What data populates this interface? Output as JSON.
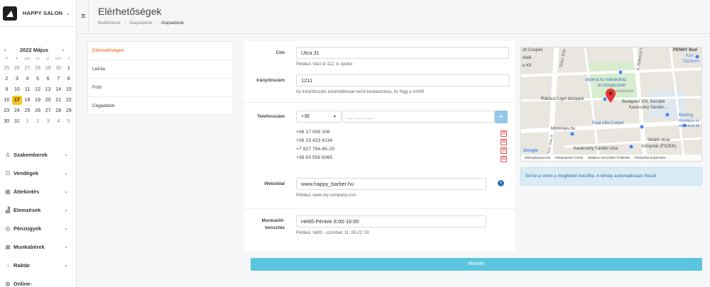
{
  "brand": {
    "name": "HAPPY SALON"
  },
  "calendar": {
    "month_label": "2022 Május",
    "prev": "‹",
    "next": "›",
    "weekdays": [
      "h",
      "k",
      "sze",
      "cs",
      "p",
      "szo",
      "v"
    ],
    "weeks": [
      [
        "25",
        "26",
        "27",
        "28",
        "29",
        "30",
        "1"
      ],
      [
        "2",
        "3",
        "4",
        "5",
        "6",
        "7",
        "8"
      ],
      [
        "9",
        "10",
        "11",
        "12",
        "13",
        "14",
        "15"
      ],
      [
        "16",
        "17",
        "18",
        "19",
        "20",
        "21",
        "22"
      ],
      [
        "23",
        "24",
        "25",
        "26",
        "27",
        "28",
        "29"
      ],
      [
        "30",
        "31",
        "1",
        "2",
        "3",
        "4",
        "5"
      ]
    ],
    "selected": "17"
  },
  "nav": {
    "items": [
      {
        "label": "Szakemberek",
        "icon": "person-icon"
      },
      {
        "label": "Vendégek",
        "icon": "users-icon"
      },
      {
        "label": "Áttekintés",
        "icon": "grid-icon"
      },
      {
        "label": "Elemzések",
        "icon": "chart-icon"
      },
      {
        "label": "Pénzügyek",
        "icon": "coin-icon"
      },
      {
        "label": "Munkabérek",
        "icon": "wallet-icon"
      },
      {
        "label": "Raktár",
        "icon": "box-icon"
      },
      {
        "label": "Online-",
        "icon": "globe-icon"
      }
    ]
  },
  "header": {
    "title": "Elérhetőségek",
    "breadcrumb": [
      "Beállítások",
      "Alapadatok",
      "Alapadatok"
    ]
  },
  "settings_menu": {
    "items": [
      "Elérhetőségek",
      "Leírás",
      "Fotó",
      "Cégadatok"
    ],
    "active": "Elérhetőségek"
  },
  "form": {
    "address": {
      "label": "Cím",
      "value": "Utca 31",
      "help": "Például, Váci út 112, d. épület"
    },
    "zip": {
      "label": "Irányítószám",
      "value": "1211",
      "help": "Az irányítószám automatikusan kerül kiválasztásra, és függ a címtől"
    },
    "phone": {
      "label": "Telefonszám",
      "country_code": "+36",
      "placeholder": "__ ___ ____",
      "numbers": [
        "+36 17 008 108",
        "+36 23 423 4234",
        "+7 927 754-85-29",
        "+36 63 558 6365"
      ]
    },
    "website": {
      "label": "Weboldal",
      "value": "www.happy_barber.hu",
      "help": "Például, www.my-company.com"
    },
    "hours": {
      "label_line1": "Munkaidő-",
      "label_line2": "beosztás",
      "value": "Hétfő-Péntek 8:00-16:00",
      "help": "Például, hétfő - szombat: 11: 00-22: 00"
    }
  },
  "save_button": "Mentés",
  "map": {
    "note": "Írd be a címet a megfelelő mezőbe. A térkép automatikusan frissül",
    "labels": [
      "ch Csepeli",
      "etalli",
      "e Kft",
      "Teller Ede út",
      "II. Rákóczi F",
      "PENNY Bud",
      "Kon",
      "Dizzkont",
      "ukpeca.hu webáruház",
      "és borgászbolt",
      "borgászbolt",
      "Rákóczi Liget lakópark",
      "Budapest XXI. Kerületi",
      "Karácsony Sándor...",
      "Motring",
      "Rövidárus és",
      "méteráruk bo",
      "Real Alfa Csepel",
      "Mommies.hu",
      "Sétáló utcai",
      "Könyvtár (FSZEK)",
      "Karácsony Sándor utca",
      "Teller Ede út",
      "Google"
    ],
    "footer": [
      "Billentyűparancsok",
      "Térképadatok ©2022",
      "Általános Szerződési Feltételek",
      "Térképhiba bejelentése"
    ]
  }
}
